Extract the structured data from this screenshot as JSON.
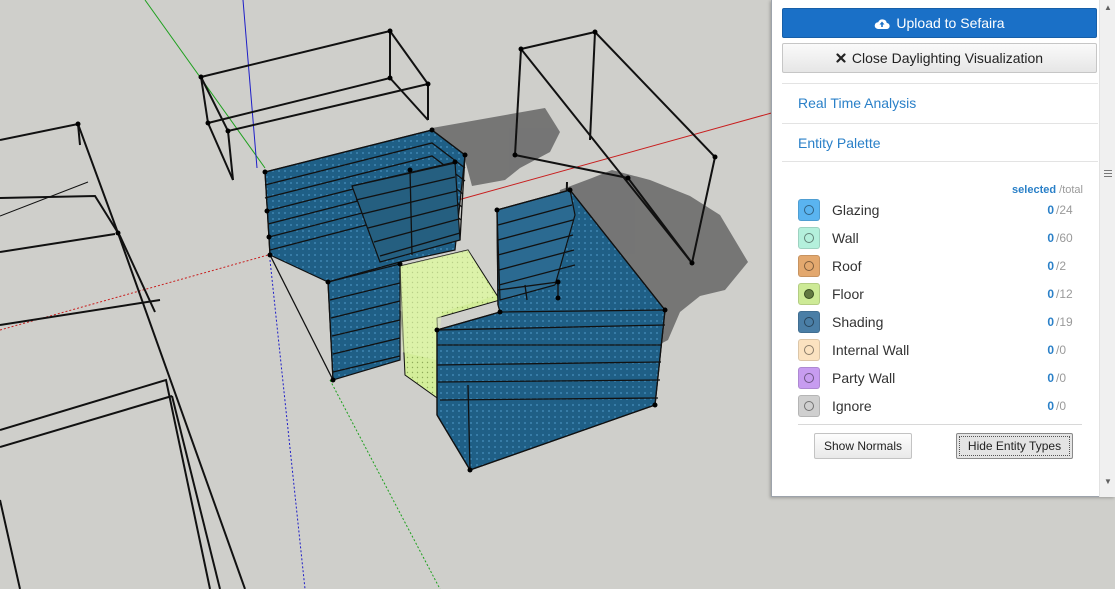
{
  "panel": {
    "upload_button": "Upload to Sefaira",
    "close_button": "Close Daylighting Visualization",
    "sections": [
      "Real Time Analysis",
      "Entity Palette"
    ],
    "table_header": {
      "selected": "selected",
      "total": "/total"
    },
    "entities": [
      {
        "name": "Glazing",
        "selected": "0",
        "total": "/24",
        "color": "#5ab4f0",
        "marker": "ring"
      },
      {
        "name": "Wall",
        "selected": "0",
        "total": "/60",
        "color": "#b4f0dc",
        "marker": "ring"
      },
      {
        "name": "Roof",
        "selected": "0",
        "total": "/2",
        "color": "#e3a86e",
        "marker": "ring"
      },
      {
        "name": "Floor",
        "selected": "0",
        "total": "/12",
        "color": "#cdea96",
        "marker": "filled"
      },
      {
        "name": "Shading",
        "selected": "0",
        "total": "/19",
        "color": "#4a7ea6",
        "marker": "ring"
      },
      {
        "name": "Internal Wall",
        "selected": "0",
        "total": "/0",
        "color": "#fbe2c0",
        "marker": "ring"
      },
      {
        "name": "Party Wall",
        "selected": "0",
        "total": "/0",
        "color": "#c79cf0",
        "marker": "ring"
      },
      {
        "name": "Ignore",
        "selected": "0",
        "total": "/0",
        "color": "#cfcfcf",
        "marker": "ring"
      }
    ],
    "show_normals_button": "Show Normals",
    "hide_entity_types_button": "Hide Entity Types"
  },
  "colors": {
    "viewport_bg": "#cfcfcb",
    "slab_fill": "#1f5f86",
    "floor_fill": "#d4ee9a",
    "shadow": "#6c6c6c",
    "axis_red": "#c81e1e",
    "axis_green": "#1ea01e",
    "axis_blue": "#1e1ec8"
  }
}
